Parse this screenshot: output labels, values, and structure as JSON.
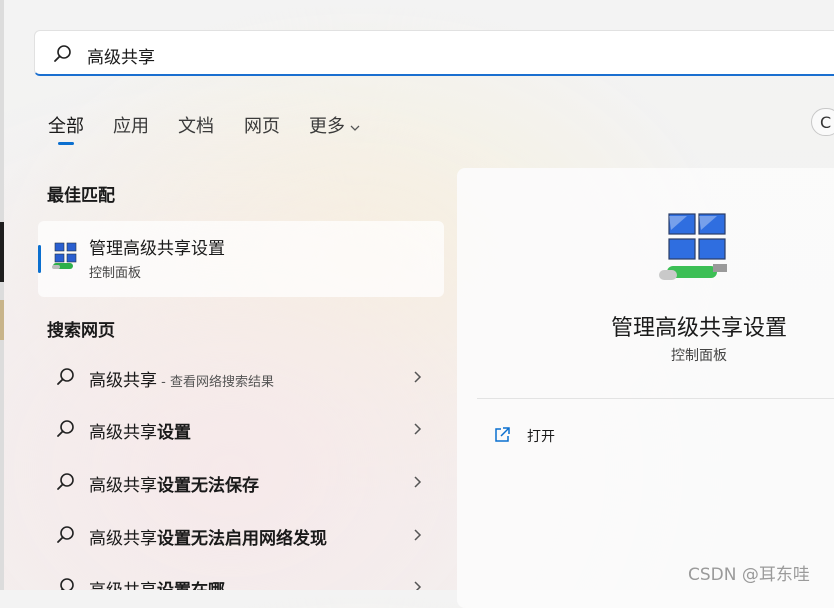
{
  "search": {
    "query": "高级共享"
  },
  "tabs": [
    {
      "label": "全部"
    },
    {
      "label": "应用"
    },
    {
      "label": "文档"
    },
    {
      "label": "网页"
    },
    {
      "label": "更多"
    }
  ],
  "profile_button": {
    "label": "C"
  },
  "best_match": {
    "section_title": "最佳匹配",
    "title": "管理高级共享设置",
    "subtitle": "控制面板"
  },
  "web_search": {
    "section_title": "搜索网页",
    "results": [
      {
        "prefix": "高级共享",
        "bold": "",
        "suffix": " - 查看网络搜索结果"
      },
      {
        "prefix": "高级共享",
        "bold": "设置",
        "suffix": ""
      },
      {
        "prefix": "高级共享",
        "bold": "设置无法保存",
        "suffix": ""
      },
      {
        "prefix": "高级共享",
        "bold": "设置无法启用网络发现",
        "suffix": ""
      },
      {
        "prefix": "高级共享",
        "bold": "设置在哪",
        "suffix": ""
      }
    ]
  },
  "preview": {
    "title": "管理高级共享设置",
    "subtitle": "控制面板",
    "actions": [
      {
        "label": "打开",
        "icon": "open-external-icon"
      }
    ]
  },
  "watermark": "CSDN @耳东哇",
  "colors": {
    "accent": "#0b6fcf",
    "card": "#ffffff",
    "text": "#1a1a1a"
  }
}
